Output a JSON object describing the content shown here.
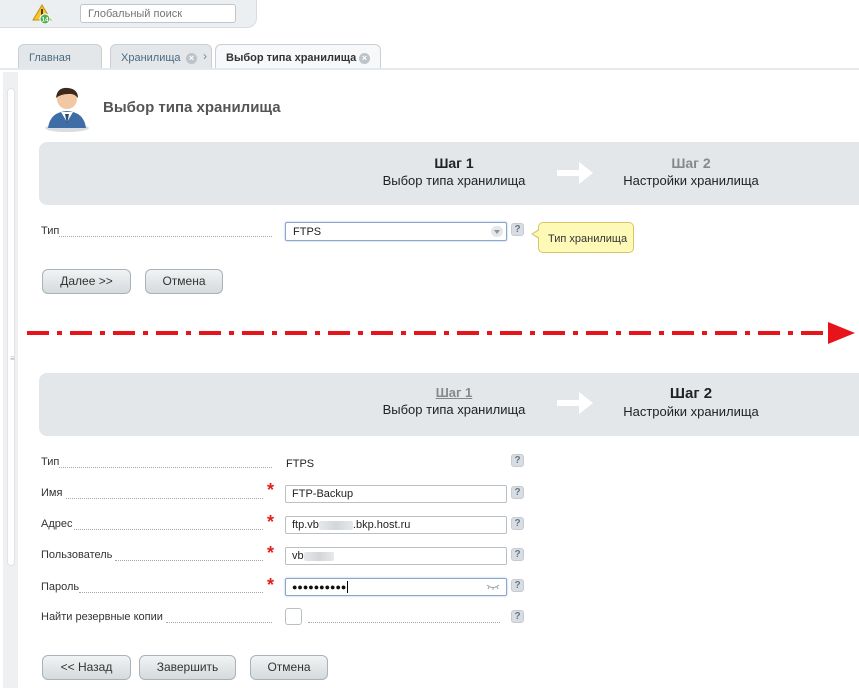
{
  "topbar": {
    "notifications_count": "14",
    "search_placeholder": "Глобальный поиск"
  },
  "tabs": [
    {
      "label": "Главная"
    },
    {
      "label": "Хранилища"
    },
    {
      "label": "Выбор типа хранилища"
    }
  ],
  "page": {
    "title": "Выбор типа хранилища"
  },
  "wizard_step1": {
    "step1_num": "Шаг 1",
    "step1_desc": "Выбор типа хранилища",
    "step2_num": "Шаг 2",
    "step2_desc": "Настройки хранилища",
    "type_label": "Тип",
    "type_value": "FTPS",
    "help": "?",
    "tooltip": "Тип хранилища",
    "next_button": "Далее >>",
    "cancel_button": "Отмена"
  },
  "wizard_step2": {
    "step1_num": "Шаг 1",
    "step1_desc": "Выбор типа хранилища",
    "step2_num": "Шаг 2",
    "step2_desc": "Настройки хранилища",
    "type_label": "Тип",
    "type_value": "FTPS",
    "name_label": "Имя",
    "name_value": "FTP-Backup",
    "address_label": "Адрес",
    "address_prefix": "ftp.vb",
    "address_suffix": ".bkp.host.ru",
    "user_label": "Пользователь",
    "user_prefix": "vb",
    "password_label": "Пароль",
    "password_mask": "●●●●●●●●●●",
    "find_backups_label": "Найти резервные копии",
    "required_mark": "*",
    "help": "?",
    "back_button": "<< Назад",
    "finish_button": "Завершить",
    "cancel_button": "Отмена"
  },
  "colors": {
    "required": "#e02020",
    "arrow": "#e8141b",
    "stepbar_bg": "#e3e7ea",
    "tooltip_bg": "#fff9b8"
  }
}
